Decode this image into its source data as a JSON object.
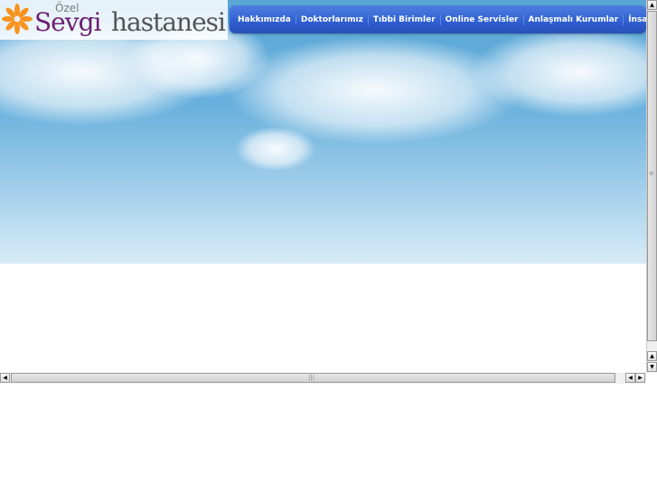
{
  "logo": {
    "prefix": "Özel",
    "name": "Sevgi",
    "suffix": "hastanesi"
  },
  "nav": [
    "Hakkımızda",
    "Doktorlarımız",
    "Tıbbi Birimler",
    "Online Servisler",
    "Anlaşmalı Kurumlar",
    "İnsan Kaynakları"
  ],
  "scroll": {
    "up": "▲",
    "down": "▼",
    "left": "◀",
    "right": "▶"
  }
}
